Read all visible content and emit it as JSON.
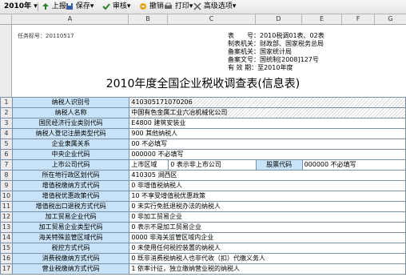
{
  "toolbar": {
    "year": "2010年",
    "report": "上报",
    "save": "保存",
    "audit": "审核",
    "revoke": "撤销",
    "print": "打印",
    "advanced": "高级选项"
  },
  "columns": [
    "A",
    "B",
    "C",
    "D",
    "E",
    "F",
    "G"
  ],
  "task_no": "任务标号：20110517",
  "meta": [
    {
      "k": "表　　号",
      "v": "2010税调01表、02表"
    },
    {
      "k": "制表机关",
      "v": "财政部、国家税务总局"
    },
    {
      "k": "备案机关",
      "v": "国家统计局"
    },
    {
      "k": "备案文号",
      "v": "国统制[2008]127号"
    },
    {
      "k": "有 效 期",
      "v": "至2010年度"
    }
  ],
  "title": "2010年度全国企业税收调查表(信息表)",
  "rows": [
    {
      "n": "1",
      "label": "纳税人识别号",
      "value": "410305171070206",
      "hatch": true
    },
    {
      "n": "2",
      "label": "纳税人名称",
      "value": "中国有色金属工业六冶机械化公司",
      "hatch": true
    },
    {
      "n": "3",
      "label": "国民经济行业类别代码",
      "value": "E4800 建筑安装业",
      "hatch": false
    },
    {
      "n": "4",
      "label": "纳税人登记注册类型代码",
      "value": "900 其他纳税人",
      "hatch": false
    },
    {
      "n": "5",
      "label": "企业隶属关系",
      "value": "00 不必填写",
      "hatch": false
    },
    {
      "n": "6",
      "label": "中央企业代码",
      "value": "000000 不必填写",
      "hatch": false
    },
    {
      "n": "7",
      "label": "上市公司代码",
      "value": "上市区域",
      "value2": "0 表示非上市公司",
      "label2": "股票代码",
      "value3": "000000 不必填写",
      "hatch": false
    },
    {
      "n": "8",
      "label": "所在地行政区划代码",
      "value": "410305 涧西区",
      "hatch": false
    },
    {
      "n": "9",
      "label": "增值税缴纳方式代码",
      "value": "0 非增值税纳税人",
      "hatch": false
    },
    {
      "n": "10",
      "label": "增值税优惠政策代码",
      "value": "10 不享受增值税优惠政策",
      "hatch": false
    },
    {
      "n": "11",
      "label": "增值税出口退税方式代码",
      "value": "0 未实行免抵退税办法的纳税人",
      "hatch": false
    },
    {
      "n": "12",
      "label": "加工贸易企业代码",
      "value": "0 非加工贸易企业",
      "hatch": false
    },
    {
      "n": "13",
      "label": "加工贸易企业类型代码",
      "value": "0 表示不是加工贸易企业",
      "hatch": false
    },
    {
      "n": "14",
      "label": "海关特殊监管区域代码",
      "value": "0000 非海关监管区域内企业",
      "hatch": false
    },
    {
      "n": "15",
      "label": "税控方式代码",
      "value": "0 未使用任何税控装置的纳税人",
      "hatch": false
    },
    {
      "n": "16",
      "label": "消费税缴纳方式代码",
      "value": "0 既非消费税纳税人也非代收（扣）代缴义务人",
      "hatch": false
    },
    {
      "n": "17",
      "label": "营业税缴纳方式代码",
      "value": "1 依率计征，独立缴纳营业税的纳税人",
      "hatch": false
    }
  ],
  "row_numbers_top": [
    "1",
    "2",
    "3",
    "4",
    "5",
    "6",
    "7"
  ]
}
